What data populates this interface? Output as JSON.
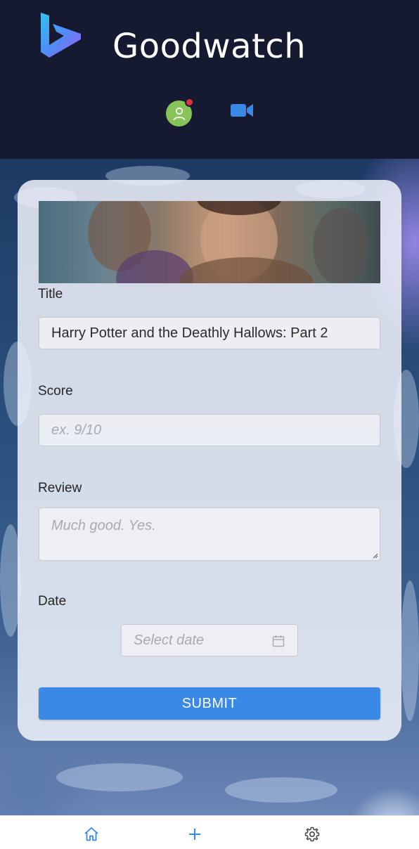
{
  "header": {
    "app_title": "Goodwatch",
    "logo_icon": "bing-logo-icon",
    "profile_icon": "user-icon",
    "video_icon": "video-camera-icon"
  },
  "form": {
    "title_label": "Title",
    "title_value": "Harry Potter and the Deathly Hallows: Part 2",
    "score_label": "Score",
    "score_placeholder": "ex. 9/10",
    "review_label": "Review",
    "review_placeholder": "Much good. Yes.",
    "date_label": "Date",
    "date_placeholder": "Select date",
    "submit_label": "SUBMIT"
  },
  "tabbar": {
    "items": [
      {
        "icon": "home-icon",
        "active": true
      },
      {
        "icon": "plus-icon",
        "active": false
      },
      {
        "icon": "gear-icon",
        "active": false
      }
    ]
  },
  "colors": {
    "header_bg": "#161a30",
    "accent": "#3a89e6",
    "avatar_bg": "#86c45a",
    "notification": "#e33142"
  }
}
